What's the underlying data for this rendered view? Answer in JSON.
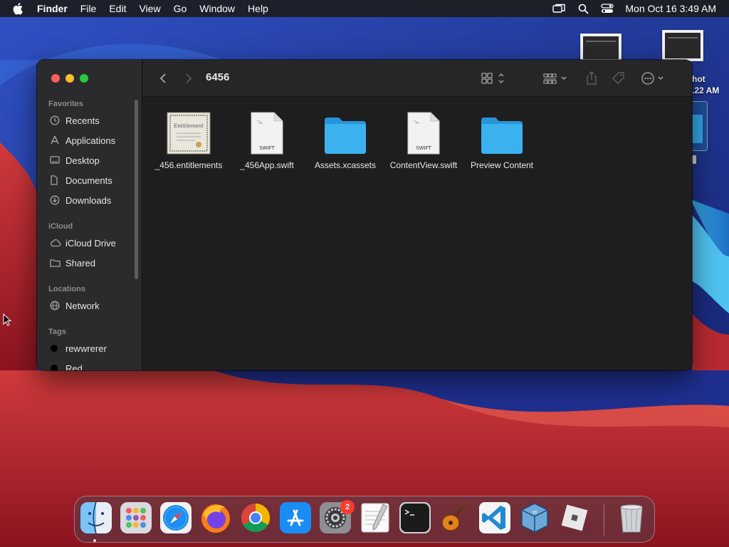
{
  "menubar": {
    "app_name": "Finder",
    "menus": [
      "File",
      "Edit",
      "View",
      "Go",
      "Window",
      "Help"
    ],
    "clock": "Mon Oct 16  3:49 AM",
    "status_icons": [
      "screen-mirroring-icon",
      "spotlight-search-icon",
      "control-center-icon"
    ]
  },
  "desktop": {
    "screenshot_label_partial_1": "hot",
    "screenshot_label_partial_2": ".22 AM"
  },
  "finder": {
    "title": "6456",
    "sidebar": {
      "sections": [
        {
          "title": "Favorites",
          "items": [
            {
              "label": "Recents",
              "icon": "clock-icon"
            },
            {
              "label": "Applications",
              "icon": "applications-icon"
            },
            {
              "label": "Desktop",
              "icon": "desktop-icon"
            },
            {
              "label": "Documents",
              "icon": "document-icon"
            },
            {
              "label": "Downloads",
              "icon": "download-icon"
            }
          ]
        },
        {
          "title": "iCloud",
          "items": [
            {
              "label": "iCloud Drive",
              "icon": "cloud-icon"
            },
            {
              "label": "Shared",
              "icon": "shared-folder-icon"
            }
          ]
        },
        {
          "title": "Locations",
          "items": [
            {
              "label": "Network",
              "icon": "globe-icon"
            }
          ]
        },
        {
          "title": "Tags",
          "items": [
            {
              "label": "rewwrerer",
              "icon": "tag-dot-icon",
              "color": "#000000"
            },
            {
              "label": "Red",
              "icon": "tag-dot-icon",
              "color": "#000000"
            }
          ]
        }
      ]
    },
    "files": [
      {
        "name": "_456.entitlements",
        "kind": "entitlements"
      },
      {
        "name": "_456App.swift",
        "kind": "swift",
        "badge": "SWIFT"
      },
      {
        "name": "Assets.xcassets",
        "kind": "folder"
      },
      {
        "name": "ContentView.swift",
        "kind": "swift",
        "badge": "SWIFT"
      },
      {
        "name": "Preview Content",
        "kind": "folder"
      }
    ]
  },
  "dock": {
    "apps": [
      "Finder",
      "Launchpad",
      "Safari",
      "Firefox",
      "Google Chrome",
      "App Store",
      "System Settings",
      "TextEdit",
      "Terminal",
      "GarageBand",
      "Visual Studio Code",
      "VirtualBox",
      "Roblox",
      "Trash"
    ],
    "system_settings_badge": "2"
  },
  "colors": {
    "folder_blue": "#35a8ea",
    "window_bg": "#1e1e1e",
    "sidebar_bg": "#2b2b2e"
  }
}
